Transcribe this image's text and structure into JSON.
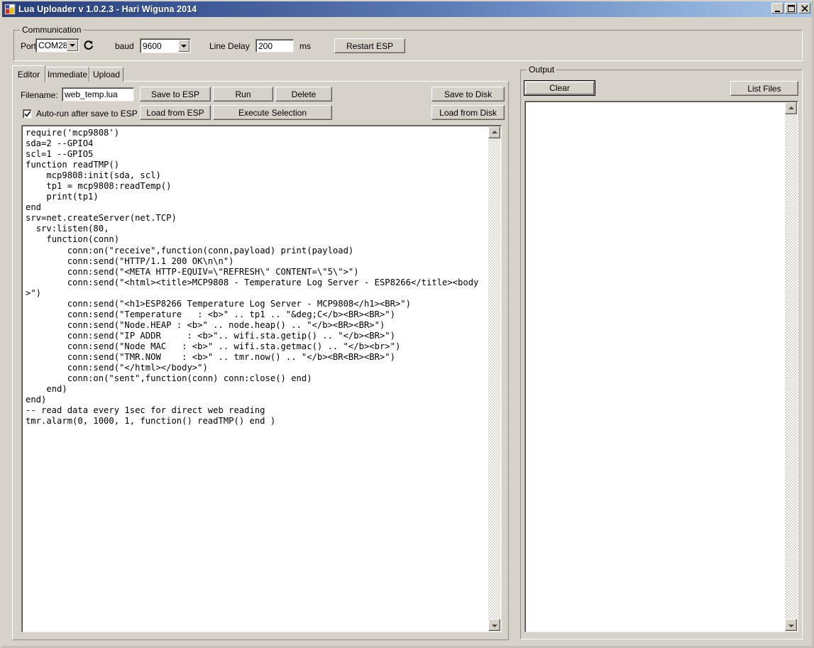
{
  "window": {
    "title": "Lua Uploader v 1.0.2.3 - Hari Wiguna 2014",
    "icon": "app-icon",
    "controls": {
      "minimize": "minimize-icon",
      "maximize": "maximize-icon",
      "close": "close-icon"
    }
  },
  "communication": {
    "group_label": "Communication",
    "port_label": "Port",
    "port_value": "COM28",
    "refresh_icon": "refresh-icon",
    "baud_label": "baud",
    "baud_value": "9600",
    "line_delay_label": "Line Delay",
    "line_delay_value": "200",
    "ms_label": "ms",
    "restart_button": "Restart ESP"
  },
  "tabs": [
    {
      "label": "Editor",
      "selected": true
    },
    {
      "label": "Immediate",
      "selected": false
    },
    {
      "label": "Upload",
      "selected": false
    }
  ],
  "editor": {
    "filename_label": "Filename:",
    "filename_value": "web_temp.lua",
    "autorun_label": "Auto-run after save to ESP",
    "autorun_checked": true,
    "buttons": {
      "save_to_esp": "Save to ESP",
      "run": "Run",
      "delete": "Delete",
      "load_from_esp": "Load from ESP",
      "execute_selection": "Execute Selection",
      "save_to_disk": "Save to Disk",
      "load_from_disk": "Load from Disk"
    },
    "code": "require('mcp9808')\nsda=2 --GPIO4\nscl=1 --GPIO5\nfunction readTMP()\n    mcp9808:init(sda, scl)\n    tp1 = mcp9808:readTemp()\n    print(tp1)\nend\nsrv=net.createServer(net.TCP)\n  srv:listen(80,\n    function(conn)\n        conn:on(\"receive\",function(conn,payload) print(payload)\n        conn:send(\"HTTP/1.1 200 OK\\n\\n\")\n        conn:send(\"<META HTTP-EQUIV=\\\"REFRESH\\\" CONTENT=\\\"5\\\">\")\n        conn:send(\"<html><title>MCP9808 - Temperature Log Server - ESP8266</title><body>\")\n        conn:send(\"<h1>ESP8266 Temperature Log Server - MCP9808</h1><BR>\")\n        conn:send(\"Temperature   : <b>\" .. tp1 .. \"&deg;C</b><BR><BR>\")\n        conn:send(\"Node.HEAP : <b>\" .. node.heap() .. \"</b><BR><BR>\")\n        conn:send(\"IP ADDR     : <b>\".. wifi.sta.getip() .. \"</b><BR>\")\n        conn:send(\"Node MAC   : <b>\" .. wifi.sta.getmac() .. \"</b><br>\")\n        conn:send(\"TMR.NOW    : <b>\" .. tmr.now() .. \"</b><BR<BR><BR>\")\n        conn:send(\"</html></body>\")\n        conn:on(\"sent\",function(conn) conn:close() end)\n    end)\nend)\n-- read data every 1sec for direct web reading\ntmr.alarm(0, 1000, 1, function() readTMP() end )"
  },
  "output": {
    "group_label": "Output",
    "clear_button": "Clear",
    "list_files_button": "List Files",
    "log_text": ""
  },
  "colors": {
    "window_background": "#d6d2ca",
    "titlebar_start": "#28407c",
    "titlebar_end": "#a8c4e6",
    "field_background": "#ffffff",
    "text": "#000000"
  }
}
